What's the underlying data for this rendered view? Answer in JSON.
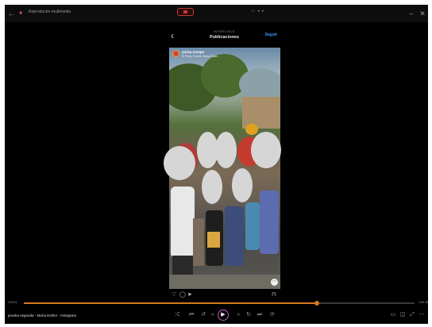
{
  "window": {
    "title": "Reproductor multimedia",
    "close_glyph": "✕",
    "minimize_glyph": "–",
    "mini_indicator": "▭ ◂ ▸"
  },
  "instagram": {
    "username_small": "INTERCHILE",
    "page_title": "Publicaciones",
    "follow_label": "Seguir",
    "back_glyph": "‹",
    "post": {
      "username": "yurita.crespo",
      "location": "El Pinar, Puente Santa Rosa..."
    },
    "actions": [
      "♡",
      "◯",
      "➤",
      "⊓"
    ]
  },
  "player": {
    "current_time": "0:00:11",
    "total_time": "0:00:15",
    "progress": 0.75,
    "media_title": "prueba segunda - María Esther - Instagram",
    "colors": {
      "accent": "#d6771f",
      "play_ring": "#c05cc0"
    },
    "icons": [
      "shuffle-icon",
      "previous-icon",
      "rewind-icon",
      "play-icon",
      "forward-icon",
      "next-icon",
      "repeat-icon",
      "miniplayer-icon",
      "cast-icon",
      "fullscreen-icon",
      "more-icon"
    ]
  }
}
